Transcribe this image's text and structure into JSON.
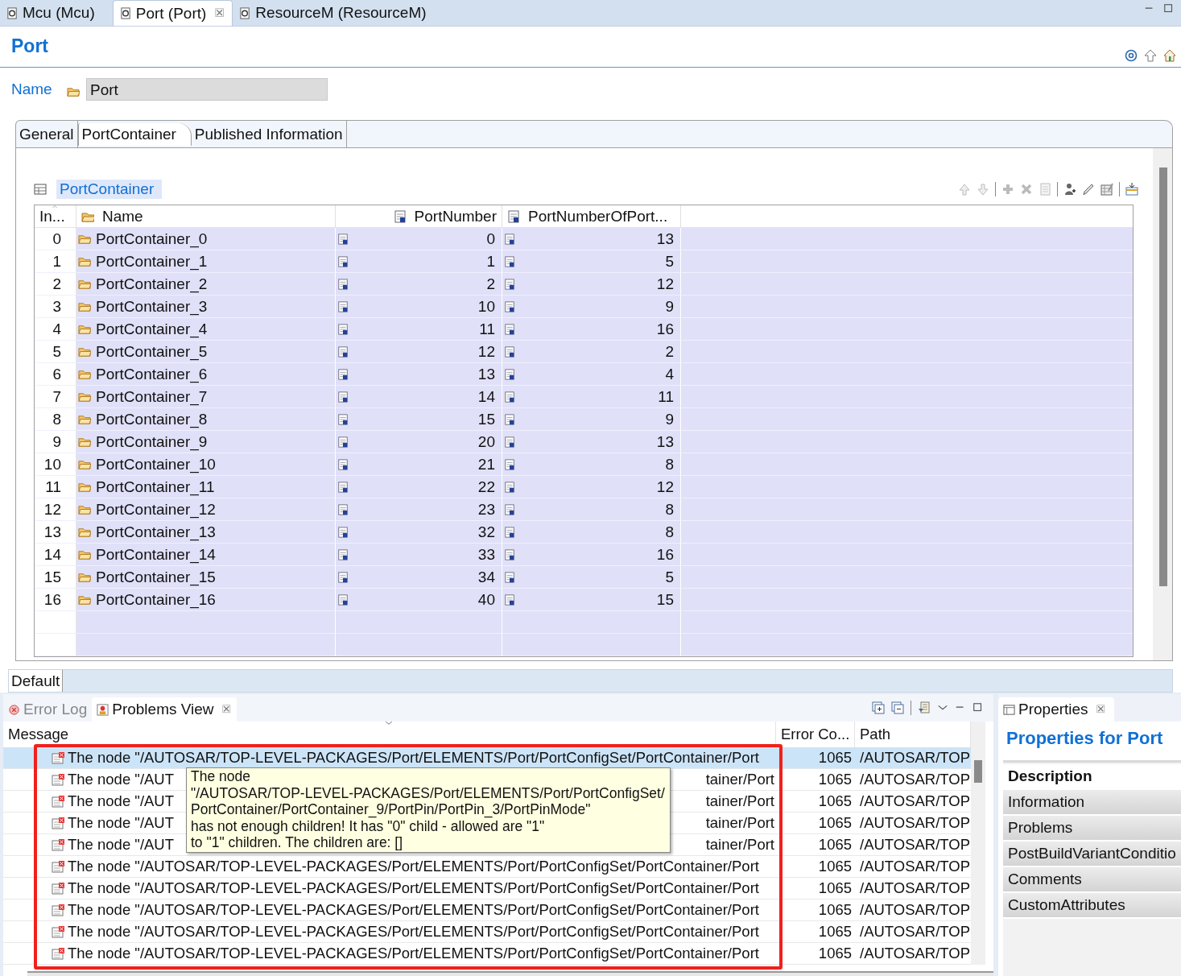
{
  "editor_tabs": [
    {
      "label": "Mcu (Mcu)",
      "selected": false,
      "closable": false
    },
    {
      "label": "Port (Port)",
      "selected": true,
      "closable": true
    },
    {
      "label": "ResourceM (ResourceM)",
      "selected": false,
      "closable": false
    }
  ],
  "page": {
    "title": "Port",
    "name_label": "Name",
    "name_value": "Port"
  },
  "form_tabs": [
    {
      "label": "General",
      "selected": false
    },
    {
      "label": "PortContainer",
      "selected": true
    },
    {
      "label": "Published Information",
      "selected": false
    }
  ],
  "section": {
    "title": "PortContainer"
  },
  "table": {
    "columns": [
      {
        "label": "In...",
        "sorted": true
      },
      {
        "label": "Name",
        "sorted": false
      },
      {
        "label": "PortNumber",
        "sorted": false
      },
      {
        "label": "PortNumberOfPort...",
        "sorted": false
      }
    ],
    "rows": [
      {
        "index": "0",
        "name": "PortContainer_0",
        "port_number": "0",
        "pins": "13"
      },
      {
        "index": "1",
        "name": "PortContainer_1",
        "port_number": "1",
        "pins": "5"
      },
      {
        "index": "2",
        "name": "PortContainer_2",
        "port_number": "2",
        "pins": "12"
      },
      {
        "index": "3",
        "name": "PortContainer_3",
        "port_number": "10",
        "pins": "9"
      },
      {
        "index": "4",
        "name": "PortContainer_4",
        "port_number": "11",
        "pins": "16"
      },
      {
        "index": "5",
        "name": "PortContainer_5",
        "port_number": "12",
        "pins": "2"
      },
      {
        "index": "6",
        "name": "PortContainer_6",
        "port_number": "13",
        "pins": "4"
      },
      {
        "index": "7",
        "name": "PortContainer_7",
        "port_number": "14",
        "pins": "11"
      },
      {
        "index": "8",
        "name": "PortContainer_8",
        "port_number": "15",
        "pins": "9"
      },
      {
        "index": "9",
        "name": "PortContainer_9",
        "port_number": "20",
        "pins": "13"
      },
      {
        "index": "10",
        "name": "PortContainer_10",
        "port_number": "21",
        "pins": "8"
      },
      {
        "index": "11",
        "name": "PortContainer_11",
        "port_number": "22",
        "pins": "12"
      },
      {
        "index": "12",
        "name": "PortContainer_12",
        "port_number": "23",
        "pins": "8"
      },
      {
        "index": "13",
        "name": "PortContainer_13",
        "port_number": "32",
        "pins": "8"
      },
      {
        "index": "14",
        "name": "PortContainer_14",
        "port_number": "33",
        "pins": "16"
      },
      {
        "index": "15",
        "name": "PortContainer_15",
        "port_number": "34",
        "pins": "5"
      },
      {
        "index": "16",
        "name": "PortContainer_16",
        "port_number": "40",
        "pins": "15"
      }
    ]
  },
  "bottom_tab": {
    "label": "Default"
  },
  "problems": {
    "tabs": [
      {
        "label": "Error Log",
        "selected": false,
        "closable": false
      },
      {
        "label": "Problems View",
        "selected": true,
        "closable": true
      }
    ],
    "columns": [
      "Message",
      "Error Co...",
      "Path"
    ],
    "rows": [
      {
        "selected": true,
        "message": "The node \"/AUTOSAR/TOP-LEVEL-PACKAGES/Port/ELEMENTS/Port/PortConfigSet/PortContainer/Port",
        "code": "1065",
        "path": "/AUTOSAR/TOP"
      },
      {
        "selected": false,
        "message_head": "The node \"/AUT",
        "message_tail": "tainer/Port",
        "code": "1065",
        "path": "/AUTOSAR/TOP"
      },
      {
        "selected": false,
        "message_head": "The node \"/AUT",
        "message_tail": "tainer/Port",
        "code": "1065",
        "path": "/AUTOSAR/TOP"
      },
      {
        "selected": false,
        "message_head": "The node \"/AUT",
        "message_tail": "tainer/Port",
        "code": "1065",
        "path": "/AUTOSAR/TOP"
      },
      {
        "selected": false,
        "message_head": "The node \"/AUT",
        "message_tail": "tainer/Port",
        "code": "1065",
        "path": "/AUTOSAR/TOP"
      },
      {
        "selected": false,
        "message": "The node \"/AUTOSAR/TOP-LEVEL-PACKAGES/Port/ELEMENTS/Port/PortConfigSet/PortContainer/Port",
        "code": "1065",
        "path": "/AUTOSAR/TOP"
      },
      {
        "selected": false,
        "message": "The node \"/AUTOSAR/TOP-LEVEL-PACKAGES/Port/ELEMENTS/Port/PortConfigSet/PortContainer/Port",
        "code": "1065",
        "path": "/AUTOSAR/TOP"
      },
      {
        "selected": false,
        "message": "The node \"/AUTOSAR/TOP-LEVEL-PACKAGES/Port/ELEMENTS/Port/PortConfigSet/PortContainer/Port",
        "code": "1065",
        "path": "/AUTOSAR/TOP"
      },
      {
        "selected": false,
        "message": "The node \"/AUTOSAR/TOP-LEVEL-PACKAGES/Port/ELEMENTS/Port/PortConfigSet/PortContainer/Port",
        "code": "1065",
        "path": "/AUTOSAR/TOP"
      },
      {
        "selected": false,
        "message": "The node \"/AUTOSAR/TOP-LEVEL-PACKAGES/Port/ELEMENTS/Port/PortConfigSet/PortContainer/Port",
        "code": "1065",
        "path": "/AUTOSAR/TOP"
      }
    ],
    "tooltip": {
      "lines": [
        "The node",
        "\"/AUTOSAR/TOP-LEVEL-PACKAGES/Port/ELEMENTS/Port/PortConfigSet/",
        "PortContainer/PortContainer_9/PortPin/PortPin_3/PortPinMode\"",
        "has not enough children! It has \"0\" child - allowed are \"1\"",
        "to \"1\" children. The children are: []"
      ]
    }
  },
  "properties": {
    "tab": {
      "label": "Properties",
      "closable": true
    },
    "title": "Properties for Port",
    "sections": [
      {
        "label": "Description",
        "selected": true
      },
      {
        "label": "Information",
        "selected": false
      },
      {
        "label": "Problems",
        "selected": false
      },
      {
        "label": "PostBuildVariantConditio",
        "selected": false
      },
      {
        "label": "Comments",
        "selected": false
      },
      {
        "label": "CustomAttributes",
        "selected": false
      }
    ]
  }
}
